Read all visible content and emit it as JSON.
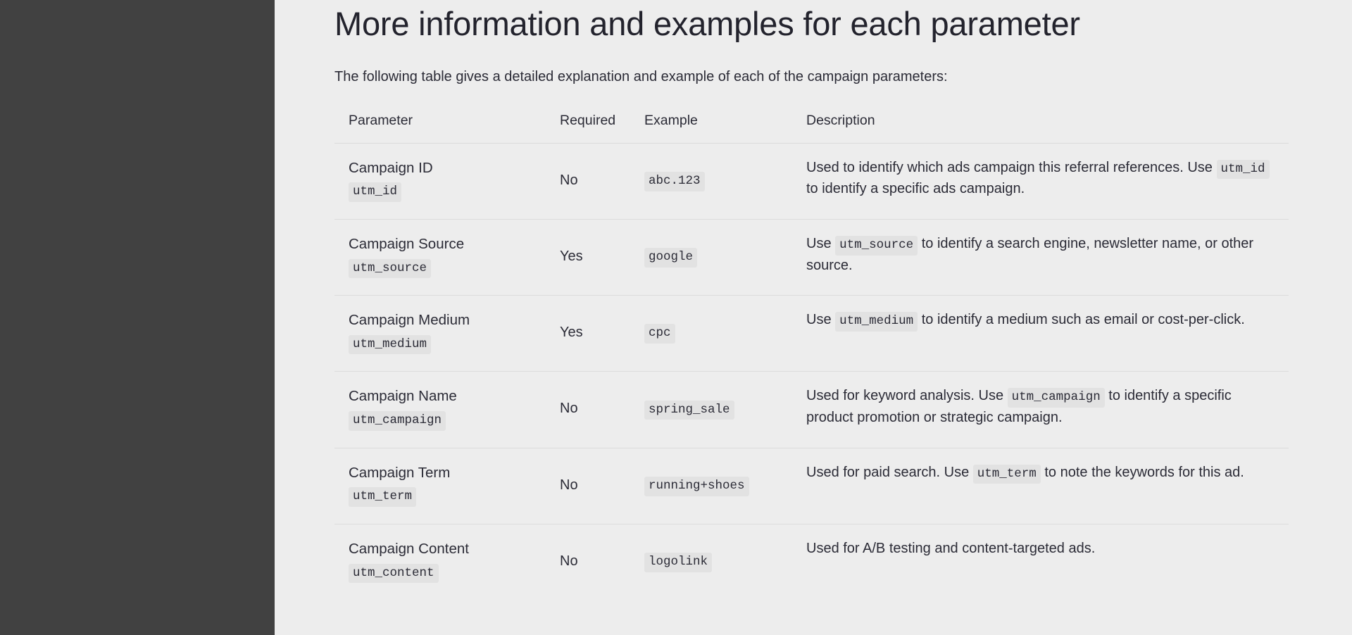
{
  "theme": {
    "page_background": "#ededed",
    "sidebar_color": "#414141",
    "text_color": "#2b2b36",
    "code_background": "#e2e2e2",
    "rule_color": "#dcdcdc"
  },
  "main": {
    "title": "More information and examples for each parameter",
    "intro": "The following table gives a detailed explanation and example of each of the campaign parameters:",
    "table": {
      "columns": [
        "Parameter",
        "Required",
        "Example",
        "Description"
      ],
      "rows": [
        {
          "parameter": "Campaign ID",
          "parameter_code": "utm_id",
          "required": "No",
          "example": "abc.123",
          "description_parts": [
            {
              "type": "text",
              "value": "Used to identify which ads campaign this referral references. Use "
            },
            {
              "type": "code",
              "value": "utm_id"
            },
            {
              "type": "text",
              "value": " to identify a specific ads campaign."
            }
          ]
        },
        {
          "parameter": "Campaign Source",
          "parameter_code": "utm_source",
          "required": "Yes",
          "example": "google",
          "description_parts": [
            {
              "type": "text",
              "value": "Use "
            },
            {
              "type": "code",
              "value": "utm_source"
            },
            {
              "type": "text",
              "value": " to identify a search engine, newsletter name, or other source."
            }
          ]
        },
        {
          "parameter": "Campaign Medium",
          "parameter_code": "utm_medium",
          "required": "Yes",
          "example": "cpc",
          "description_parts": [
            {
              "type": "text",
              "value": "Use "
            },
            {
              "type": "code",
              "value": "utm_medium"
            },
            {
              "type": "text",
              "value": " to identify a medium such as email or cost-per-click."
            }
          ]
        },
        {
          "parameter": "Campaign Name",
          "parameter_code": "utm_campaign",
          "required": "No",
          "example": "spring_sale",
          "description_parts": [
            {
              "type": "text",
              "value": "Used for keyword analysis. Use "
            },
            {
              "type": "code",
              "value": "utm_campaign"
            },
            {
              "type": "text",
              "value": " to identify a specific product promotion or strategic campaign."
            }
          ]
        },
        {
          "parameter": "Campaign Term",
          "parameter_code": "utm_term",
          "required": "No",
          "example": "running+shoes",
          "description_parts": [
            {
              "type": "text",
              "value": "Used for paid search. Use "
            },
            {
              "type": "code",
              "value": "utm_term"
            },
            {
              "type": "text",
              "value": " to note the keywords for this ad."
            }
          ]
        },
        {
          "parameter": "Campaign Content",
          "parameter_code": "utm_content",
          "required": "No",
          "example": "logolink",
          "description_parts": [
            {
              "type": "text",
              "value": "Used for A/B testing and content-targeted ads."
            }
          ]
        }
      ]
    }
  }
}
